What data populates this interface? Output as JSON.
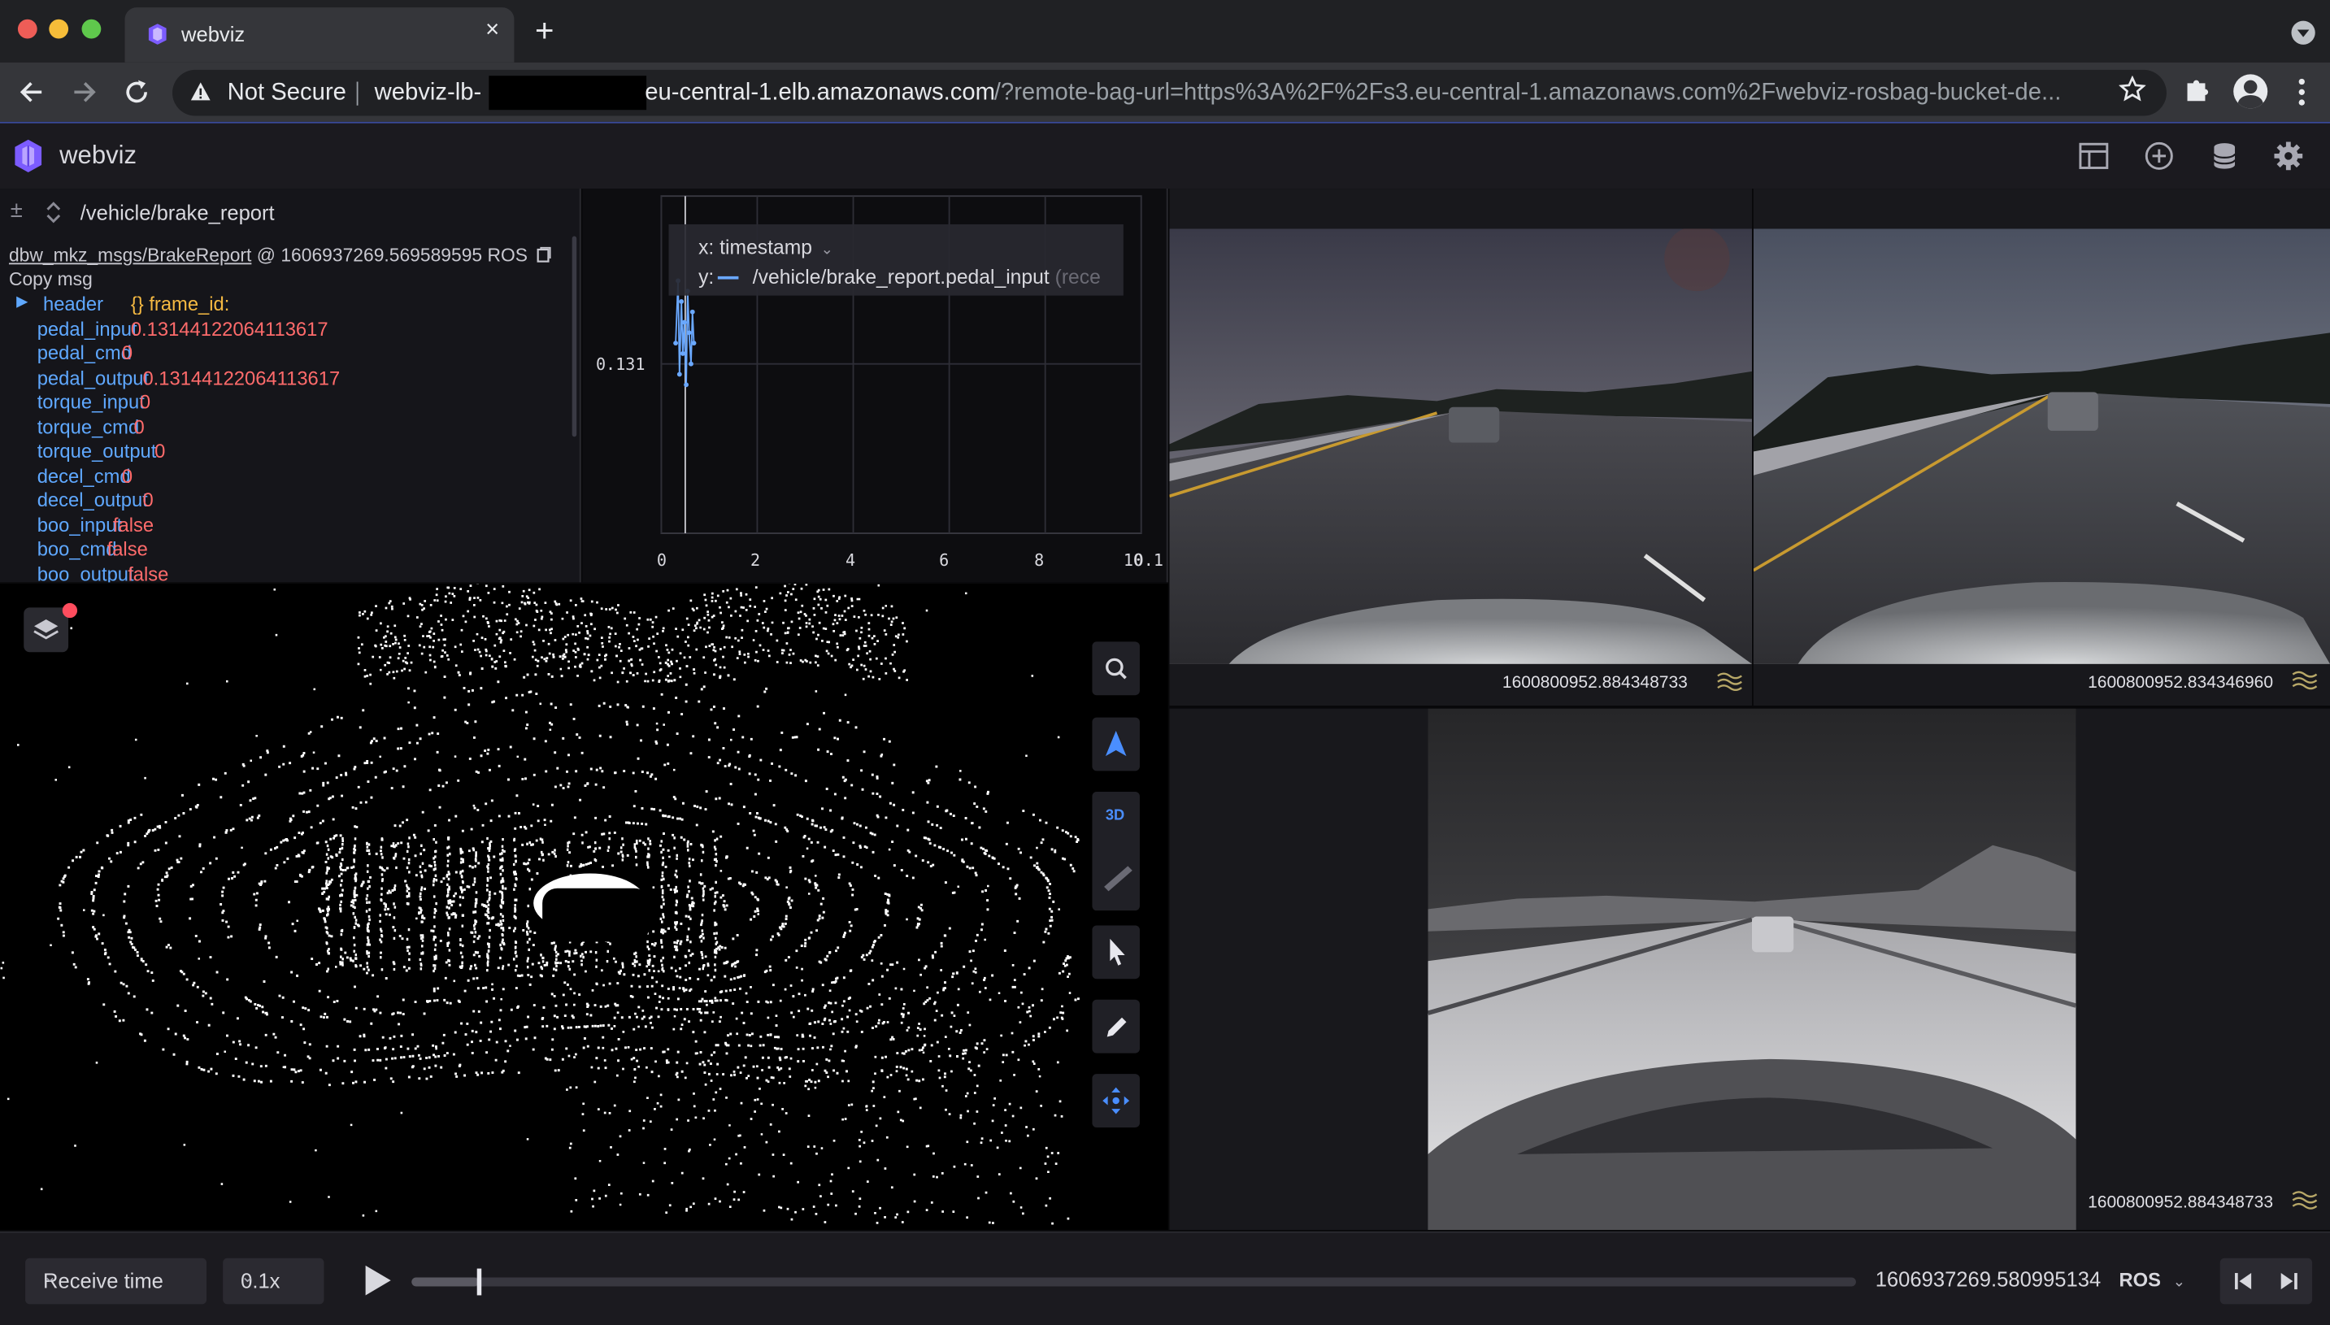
{
  "browser": {
    "tab_title": "webviz",
    "tab_close": "×",
    "new_tab": "+",
    "security_label": "Not Secure",
    "url_host": "webviz-lb-",
    "url_domain": "eu-central-1.elb.amazonaws.com",
    "url_path": "/?remote-bag-url=https%3A%2F%2Fs3.eu-central-1.amazonaws.com%2Fwebviz-rosbag-bucket-de..."
  },
  "app": {
    "name": "webviz",
    "accent_color": "#7c5cff"
  },
  "raw_messages": {
    "topic": "/vehicle/brake_report",
    "datatype": "dbw_mkz_msgs/BrakeReport",
    "at": "@",
    "timestamp": "1606937269.569589595 ROS",
    "copy_label": "Copy msg",
    "header_key": "header",
    "header_value": "{} frame_id:",
    "fields": [
      {
        "key": "pedal_input",
        "value": "0.13144122064113617"
      },
      {
        "key": "pedal_cmd",
        "value": "0"
      },
      {
        "key": "pedal_output",
        "value": "0.13144122064113617"
      },
      {
        "key": "torque_input",
        "value": "0"
      },
      {
        "key": "torque_cmd",
        "value": "0"
      },
      {
        "key": "torque_output",
        "value": "0"
      },
      {
        "key": "decel_cmd",
        "value": "0"
      },
      {
        "key": "decel_output",
        "value": "0"
      },
      {
        "key": "boo_input",
        "value": "false"
      },
      {
        "key": "boo_cmd",
        "value": "false"
      },
      {
        "key": "boo_output",
        "value": "false"
      }
    ]
  },
  "plot": {
    "x_prefix": "x:",
    "x_axis": "timestamp",
    "y_prefix": "y:",
    "y_path": "/vehicle/brake_report.pedal_input",
    "y_suffix": "(rece",
    "series_color": "#6aa8ff",
    "y_tick": "0.131",
    "x_ticks": [
      "0",
      "2",
      "4",
      "6",
      "8",
      "10",
      "0.1"
    ]
  },
  "chart_data": {
    "type": "line",
    "xlabel": "",
    "ylabel": "",
    "xlim": [
      0,
      10
    ],
    "y_ticks": [
      0.131
    ],
    "x_ticks": [
      0,
      2,
      4,
      6,
      8,
      10
    ],
    "series": [
      {
        "name": "/vehicle/brake_report.pedal_input",
        "x": [
          0.3,
          0.35,
          0.38,
          0.42,
          0.45,
          0.48,
          0.52,
          0.55,
          0.58,
          0.62,
          0.65,
          0.68
        ],
        "y": [
          0.1312,
          0.1318,
          0.1309,
          0.1316,
          0.1311,
          0.1314,
          0.1308,
          0.1317,
          0.1313,
          0.131,
          0.1315,
          0.1312
        ]
      }
    ]
  },
  "cameras": [
    {
      "timestamp": "1600800952.884348733"
    },
    {
      "timestamp": "1600800952.834346960"
    },
    {
      "timestamp": "1600800952.884348733"
    }
  ],
  "playback": {
    "time_mode": "Receive time",
    "speed": "0.1x",
    "current_time": "1606937269.580995134",
    "time_format": "ROS",
    "progress": 0.046
  }
}
